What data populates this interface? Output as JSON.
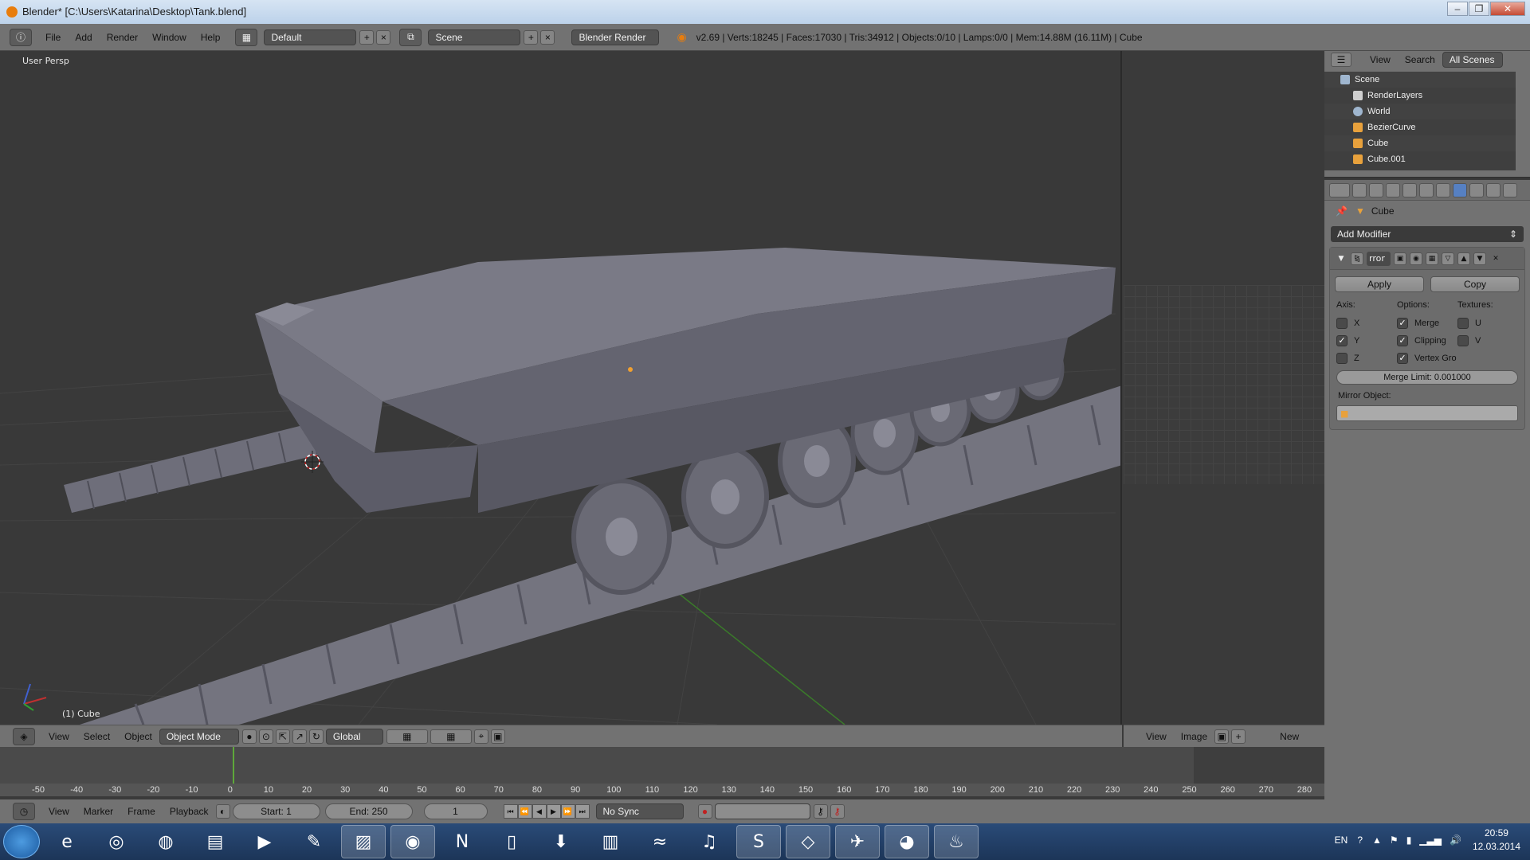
{
  "window": {
    "title": "Blender* [C:\\Users\\Katarina\\Desktop\\Tank.blend]",
    "buttons": [
      "–",
      "❐",
      "✕"
    ]
  },
  "info_header": {
    "menus": [
      "File",
      "Add",
      "Render",
      "Window",
      "Help"
    ],
    "layout": "Default",
    "scene": "Scene",
    "engine": "Blender Render",
    "stats": "v2.69 | Verts:18245 | Faces:17030 | Tris:34912 | Objects:0/10 | Lamps:0/0 | Mem:14.88M (16.11M) | Cube"
  },
  "viewport": {
    "view_label": "User Persp",
    "object_label": "(1) Cube",
    "header": {
      "menus": [
        "View",
        "Select",
        "Object"
      ],
      "mode": "Object Mode",
      "orientation": "Global"
    }
  },
  "image_editor": {
    "header": {
      "menus": [
        "View",
        "Image"
      ],
      "new_label": "New"
    }
  },
  "timeline": {
    "ticks": [
      "-50",
      "-40",
      "-30",
      "-20",
      "-10",
      "0",
      "10",
      "20",
      "30",
      "40",
      "50",
      "60",
      "70",
      "80",
      "90",
      "100",
      "110",
      "120",
      "130",
      "140",
      "150",
      "160",
      "170",
      "180",
      "190",
      "200",
      "210",
      "220",
      "230",
      "240",
      "250",
      "260",
      "270",
      "280"
    ],
    "header": {
      "menus": [
        "View",
        "Marker",
        "Frame",
        "Playback"
      ],
      "start": "Start: 1",
      "end": "End: 250",
      "current": "1",
      "sync": "No Sync"
    }
  },
  "outliner": {
    "header": {
      "view": "View",
      "search": "Search",
      "filter": "All Scenes"
    },
    "items": [
      {
        "label": "Scene",
        "color": "#9fb6cf"
      },
      {
        "label": "RenderLayers",
        "color": "#cfcfcf"
      },
      {
        "label": "World",
        "color": "#9fb6cf"
      },
      {
        "label": "BezierCurve",
        "color": "#e8a13c"
      },
      {
        "label": "Cube",
        "color": "#e8a13c"
      },
      {
        "label": "Cube.001",
        "color": "#e8a13c"
      }
    ]
  },
  "properties": {
    "breadcrumb_object": "Cube",
    "add_modifier": "Add Modifier",
    "modifier": {
      "name": "rror",
      "apply": "Apply",
      "copy": "Copy",
      "axis_title": "Axis:",
      "options_title": "Options:",
      "textures_title": "Textures:",
      "axis": [
        {
          "label": "X",
          "checked": false
        },
        {
          "label": "Y",
          "checked": true
        },
        {
          "label": "Z",
          "checked": false
        }
      ],
      "options": [
        {
          "label": "Merge",
          "checked": true
        },
        {
          "label": "Clipping",
          "checked": true
        },
        {
          "label": "Vertex Gro",
          "checked": true
        }
      ],
      "textures": [
        {
          "label": "U",
          "checked": false
        },
        {
          "label": "V",
          "checked": false
        }
      ],
      "merge_limit": "Merge Limit: 0.001000",
      "mirror_object_label": "Mirror Object:"
    }
  },
  "taskbar": {
    "language": "EN",
    "time": "20:59",
    "date": "12.03.2014",
    "apps": [
      "ie-icon",
      "chrome-icon",
      "firefox-icon",
      "explorer-icon",
      "media-icon",
      "pen-icon",
      "photos-icon",
      "spotify-icon",
      "app-n-icon",
      "document-icon",
      "download-icon",
      "files-icon",
      "wave-icon",
      "itunes-icon",
      "skype-icon",
      "unity-icon",
      "steam-game-icon",
      "blender-icon",
      "steam-icon"
    ]
  },
  "colors": {
    "accent": "#5680c2",
    "timeline_cursor": "#5ea83a",
    "blender_orange": "#e87d0d"
  }
}
